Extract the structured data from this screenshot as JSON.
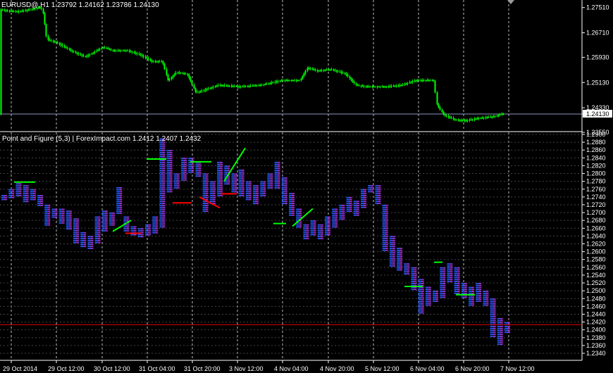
{
  "main_panel": {
    "title": "EURUSD@,H1  1.23792 1.24162 1.23786 1.24130",
    "current_price": "1.24130",
    "y_labels": [
      "1.27510",
      "1.26710",
      "1.25930",
      "1.25130",
      "1.24330",
      "1.24130",
      "1.23550"
    ]
  },
  "indicator_panel": {
    "title": "Point and Figure (5,3) | ForexImpact.com 1.2412 1.2407 1.2432",
    "y_labels": [
      "1.2900",
      "1.2880",
      "1.2860",
      "1.2840",
      "1.2820",
      "1.2800",
      "1.2780",
      "1.2760",
      "1.2740",
      "1.2720",
      "1.2700",
      "1.2680",
      "1.2660",
      "1.2640",
      "1.2620",
      "1.2600",
      "1.2580",
      "1.2560",
      "1.2540",
      "1.2520",
      "1.2500",
      "1.2480",
      "1.2460",
      "1.2440",
      "1.2420",
      "1.2400",
      "1.2380",
      "1.2360",
      "1.2340"
    ]
  },
  "x_labels": [
    "29 Oct 2014",
    "29 Oct 12:00",
    "30 Oct 12:00",
    "31 Oct 04:00",
    "31 Oct 20:00",
    "3 Nov 12:00",
    "4 Nov 04:00",
    "4 Nov 20:00",
    "5 Nov 12:00",
    "6 Nov 04:00",
    "6 Nov 20:00",
    "7 Nov 12:00"
  ],
  "colors": {
    "background": "#000000",
    "candle": "#00ff00",
    "grid": "#c0c0c0",
    "pnf_x": "#1e5cff",
    "pnf_o": "#a030d0",
    "trend_up": "#00ff00",
    "trend_down": "#ff0000",
    "support_line": "#cc0000",
    "price_line": "#8899bb"
  },
  "chart_data": [
    {
      "type": "candlestick",
      "title": "EURUSD@,H1  1.23792 1.24162 1.23786 1.24130",
      "close_path": [
        [
          0,
          1.2745
        ],
        [
          12,
          1.274
        ],
        [
          24,
          1.2738
        ],
        [
          36,
          1.2742
        ],
        [
          48,
          1.2748
        ],
        [
          56,
          1.2752
        ],
        [
          60,
          1.2745
        ],
        [
          63,
          1.27
        ],
        [
          66,
          1.265
        ],
        [
          80,
          1.264
        ],
        [
          100,
          1.2615
        ],
        [
          120,
          1.2595
        ],
        [
          130,
          1.2605
        ],
        [
          145,
          1.2625
        ],
        [
          160,
          1.2615
        ],
        [
          180,
          1.2615
        ],
        [
          200,
          1.26
        ],
        [
          215,
          1.258
        ],
        [
          230,
          1.258
        ],
        [
          238,
          1.252
        ],
        [
          250,
          1.2545
        ],
        [
          265,
          1.254
        ],
        [
          278,
          1.248
        ],
        [
          290,
          1.249
        ],
        [
          310,
          1.2505
        ],
        [
          340,
          1.25
        ],
        [
          370,
          1.2505
        ],
        [
          400,
          1.252
        ],
        [
          425,
          1.252
        ],
        [
          436,
          1.256
        ],
        [
          450,
          1.255
        ],
        [
          470,
          1.2555
        ],
        [
          490,
          1.254
        ],
        [
          505,
          1.2505
        ],
        [
          520,
          1.25
        ],
        [
          550,
          1.25
        ],
        [
          570,
          1.2505
        ],
        [
          590,
          1.252
        ],
        [
          615,
          1.252
        ],
        [
          620,
          1.244
        ],
        [
          630,
          1.241
        ],
        [
          645,
          1.2395
        ],
        [
          660,
          1.2392
        ],
        [
          680,
          1.24
        ],
        [
          700,
          1.2405
        ],
        [
          712,
          1.2413
        ]
      ],
      "ylim": [
        1.2355,
        1.2775
      ]
    },
    {
      "type": "point_and_figure",
      "title": "Point and Figure (5,3) | ForexImpact.com 1.2412 1.2407 1.2432",
      "box_size": 0.0005,
      "reversal": 3,
      "ylim": [
        1.234,
        1.29
      ],
      "columns": [
        [
          1.273,
          1.2745
        ],
        [
          1.2735,
          1.276
        ],
        [
          1.274,
          1.2775
        ],
        [
          1.2725,
          1.277
        ],
        [
          1.273,
          1.276
        ],
        [
          1.2715,
          1.2745
        ],
        [
          1.2665,
          1.272
        ],
        [
          1.2685,
          1.271
        ],
        [
          1.267,
          1.271
        ],
        [
          1.2655,
          1.2705
        ],
        [
          1.262,
          1.2685
        ],
        [
          1.261,
          1.265
        ],
        [
          1.2605,
          1.264
        ],
        [
          1.262,
          1.269
        ],
        [
          1.265,
          1.2705
        ],
        [
          1.2665,
          1.27
        ],
        [
          1.2695,
          1.2765
        ],
        [
          1.265,
          1.269
        ],
        [
          1.264,
          1.2665
        ],
        [
          1.2635,
          1.266
        ],
        [
          1.264,
          1.267
        ],
        [
          1.2645,
          1.269
        ],
        [
          1.266,
          1.289
        ],
        [
          1.275,
          1.286
        ],
        [
          1.276,
          1.28
        ],
        [
          1.278,
          1.284
        ],
        [
          1.28,
          1.284
        ],
        [
          1.279,
          1.283
        ],
        [
          1.27,
          1.28
        ],
        [
          1.272,
          1.278
        ],
        [
          1.274,
          1.283
        ],
        [
          1.277,
          1.282
        ],
        [
          1.275,
          1.28
        ],
        [
          1.274,
          1.281
        ],
        [
          1.273,
          1.278
        ],
        [
          1.272,
          1.277
        ],
        [
          1.274,
          1.278
        ],
        [
          1.276,
          1.28
        ],
        [
          1.276,
          1.283
        ],
        [
          1.272,
          1.279
        ],
        [
          1.269,
          1.275
        ],
        [
          1.266,
          1.271
        ],
        [
          1.263,
          1.267
        ],
        [
          1.264,
          1.268
        ],
        [
          1.263,
          1.267
        ],
        [
          1.264,
          1.269
        ],
        [
          1.266,
          1.271
        ],
        [
          1.268,
          1.272
        ],
        [
          1.27,
          1.274
        ],
        [
          1.269,
          1.273
        ],
        [
          1.271,
          1.276
        ],
        [
          1.275,
          1.277
        ],
        [
          1.272,
          1.277
        ],
        [
          1.26,
          1.272
        ],
        [
          1.256,
          1.264
        ],
        [
          1.255,
          1.261
        ],
        [
          1.254,
          1.257
        ],
        [
          1.25,
          1.256
        ],
        [
          1.244,
          1.253
        ],
        [
          1.246,
          1.251
        ],
        [
          1.247,
          1.25
        ],
        [
          1.248,
          1.256
        ],
        [
          1.252,
          1.257
        ],
        [
          1.249,
          1.256
        ],
        [
          1.248,
          1.252
        ],
        [
          1.246,
          1.251
        ],
        [
          1.247,
          1.252
        ],
        [
          1.246,
          1.25
        ],
        [
          1.238,
          1.248
        ],
        [
          1.236,
          1.243
        ],
        [
          1.239,
          1.242
        ]
      ]
    }
  ]
}
